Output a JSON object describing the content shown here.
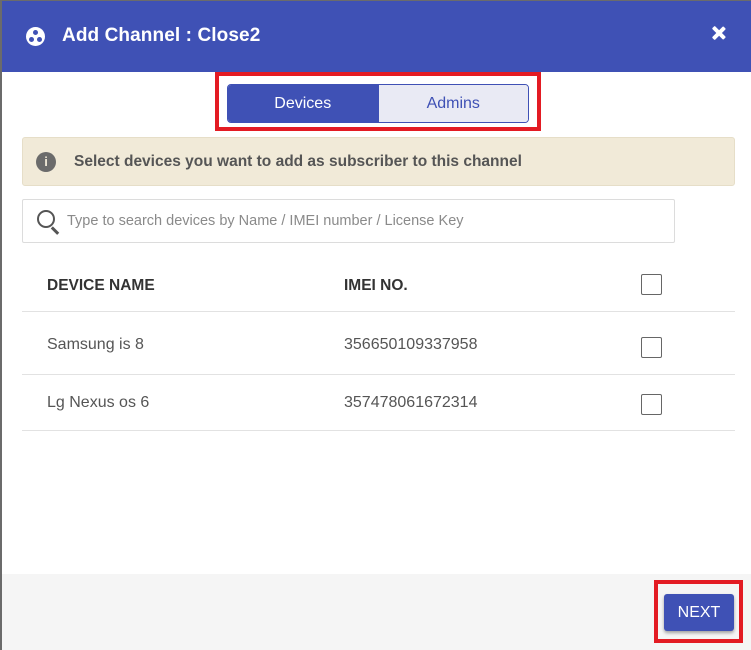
{
  "dialog": {
    "title": "Add Channel : Close2",
    "logo_icon": "channel-icon",
    "close_icon": "close-icon"
  },
  "tabs": [
    {
      "label": "Devices",
      "active": true
    },
    {
      "label": "Admins",
      "active": false
    }
  ],
  "info": {
    "icon": "info-icon",
    "icon_glyph": "i",
    "text": "Select devices you want to add as subscriber to this channel"
  },
  "search": {
    "icon": "search-icon",
    "placeholder": "Type to search devices by Name / IMEI number / License Key",
    "value": ""
  },
  "table": {
    "columns": [
      "DEVICE NAME",
      "IMEI NO."
    ],
    "select_all_checked": false,
    "rows": [
      {
        "name": "Samsung is 8",
        "imei": "356650109337958",
        "checked": false
      },
      {
        "name": "Lg Nexus os 6",
        "imei": "357478061672314",
        "checked": false
      }
    ]
  },
  "footer": {
    "next_label": "NEXT"
  },
  "colors": {
    "primary": "#3f51b5",
    "highlight": "#e31b23",
    "info_bg": "#f1ead8"
  }
}
